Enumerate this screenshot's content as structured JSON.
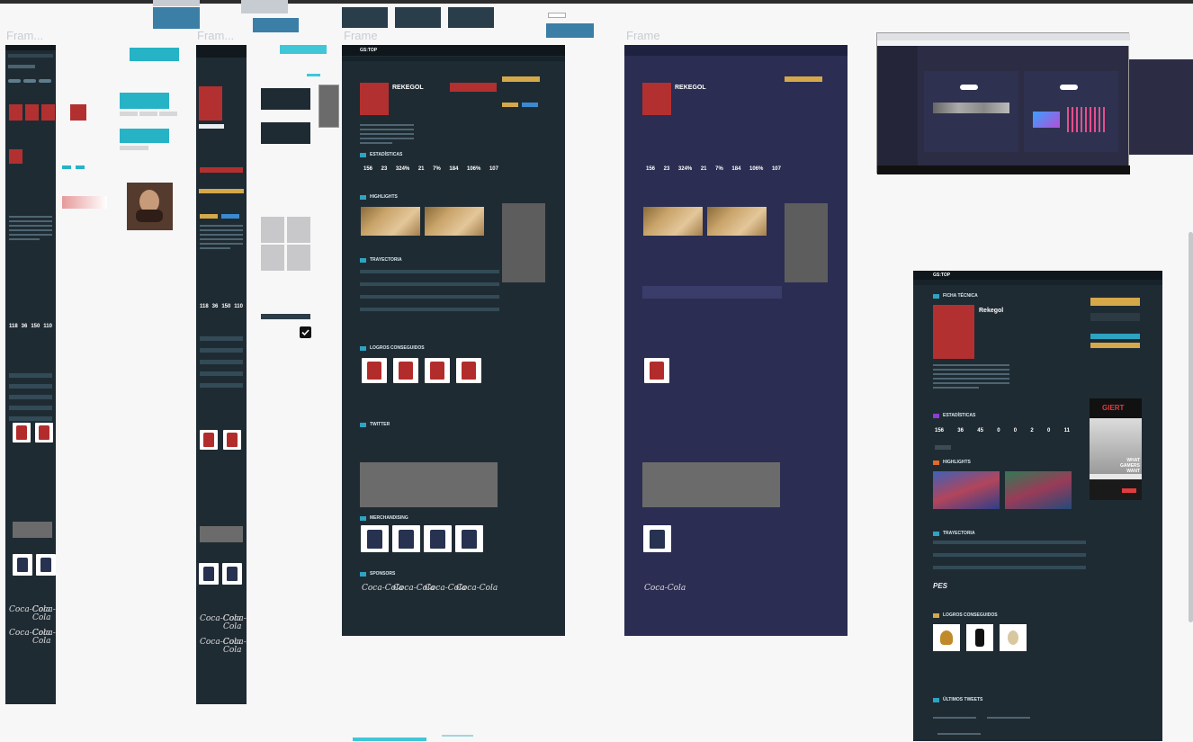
{
  "frames": {
    "frame_1_label": "Fram...",
    "frame_2_label": "Fram...",
    "frame_3_label": "Frame",
    "frame_4_label": "Frame"
  },
  "desktop": {
    "brand": "GS:TOP",
    "player_name": "REKEGOL",
    "section_statistics": "ESTADÍSTICAS",
    "section_highlights": "HIGHLIGHTS",
    "section_trajectory": "TRAYECTORIA",
    "section_achievements": "LOGROS CONSEGUIDOS",
    "section_tweets": "TWITTER",
    "section_merch": "MERCHANDISING",
    "section_sponsors": "SPONSORS",
    "sponsor_text": "Coca-Cola",
    "stats": [
      "156",
      "23",
      "324%",
      "21",
      "7%",
      "184",
      "106%",
      "107"
    ]
  },
  "navy_frame": {
    "player_name": "REKEGOL",
    "stats": [
      "156",
      "23",
      "324%",
      "21",
      "7%",
      "184",
      "106%",
      "107"
    ],
    "sponsor_text": "Coca-Cola"
  },
  "final_screen": {
    "brand": "GS:TOP",
    "tab": "FICHA TÉCNICA",
    "player_name": "Rekegol",
    "section_statistics": "ESTADÍSTICAS",
    "section_highlights": "HIGHLIGHTS",
    "section_trajectory": "TRAYECTORIA",
    "section_achievements": "LOGROS CONSEGUIDOS",
    "section_tweets": "ÚLTIMOS TWEETS",
    "stats": [
      "156",
      "36",
      "45",
      "0",
      "0",
      "2",
      "0",
      "11"
    ],
    "ad_lines": [
      "WHAT",
      "GAMERS",
      "WANT"
    ],
    "ad_brand": "GIERT",
    "pes_logo": "PES"
  },
  "mobile": {
    "sponsor_text": "Coca-Cola"
  },
  "colors": {
    "dark_panel": "#1f2b33",
    "navy_panel": "#2b2d52",
    "accent_teal": "#27b3c6",
    "accent_gold": "#d5a84a"
  }
}
